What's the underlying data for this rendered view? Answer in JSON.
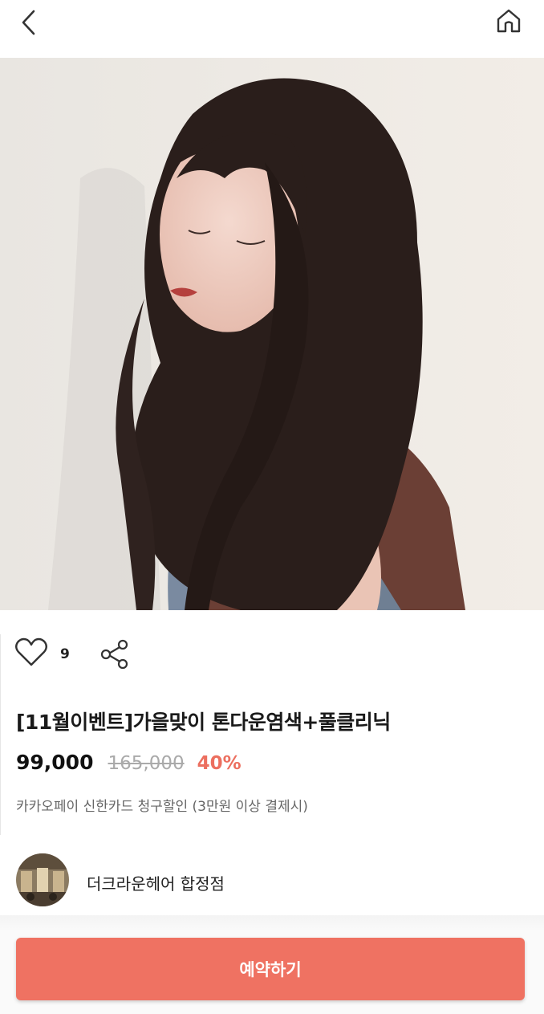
{
  "header": {
    "back_icon": "chevron-left-icon",
    "home_icon": "home-icon"
  },
  "product": {
    "image_alt": "hair style photo",
    "likes": "9",
    "title": "[11월이벤트]가을맞이 톤다운염색+풀클리닉",
    "price": "99,000",
    "original_price": "165,000",
    "discount": "40%",
    "promo": "카카오페이 신한카드 청구할인 (3만원 이상 결제시)"
  },
  "shop": {
    "name": "더크라운헤어 합정점"
  },
  "cta": {
    "label": "예약하기"
  },
  "colors": {
    "accent": "#ef7262",
    "discount": "#ec6f5f"
  }
}
